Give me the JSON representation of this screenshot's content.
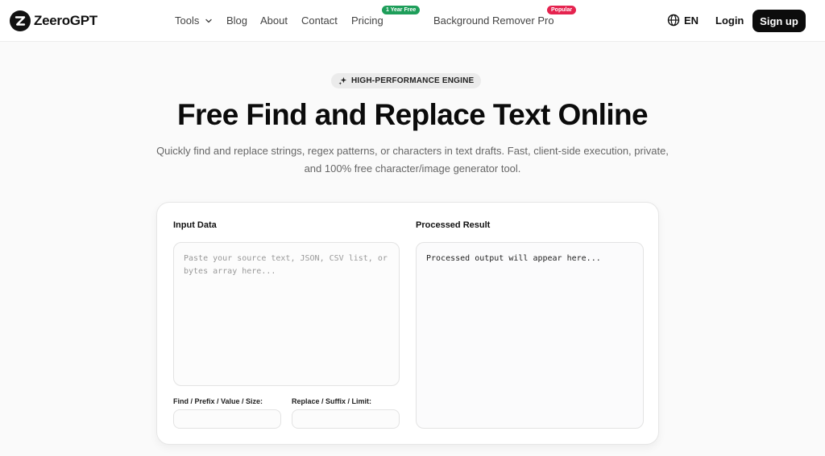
{
  "header": {
    "logo_text": "ZeeroGPT",
    "nav": {
      "tools": "Tools",
      "blog": "Blog",
      "about": "About",
      "contact": "Contact",
      "pricing": "Pricing",
      "pricing_badge": "1 Year Free",
      "bg_remover": "Background Remover Pro",
      "bg_remover_badge": "Popular"
    },
    "language": "EN",
    "login": "Login",
    "signup": "Sign up"
  },
  "hero": {
    "pill": "HIGH-PERFORMANCE ENGINE",
    "title": "Free Find and Replace Text Online",
    "subtitle": "Quickly find and replace strings, regex patterns, or characters in text drafts. Fast, client-side execution, private, and 100% free character/image generator tool."
  },
  "tool": {
    "input_label": "Input Data",
    "input_placeholder": "Paste your source text, JSON, CSV list, or bytes array here...",
    "input_value": "",
    "result_label": "Processed Result",
    "result_placeholder": "Processed output will appear here...",
    "find_label": "Find / Prefix / Value / Size:",
    "find_value": "",
    "replace_label": "Replace / Suffix / Limit:",
    "replace_value": ""
  },
  "colors": {
    "badge_free": "#1e9e5a",
    "badge_popular": "#e5234f",
    "signup_bg": "#0c0c0c"
  }
}
